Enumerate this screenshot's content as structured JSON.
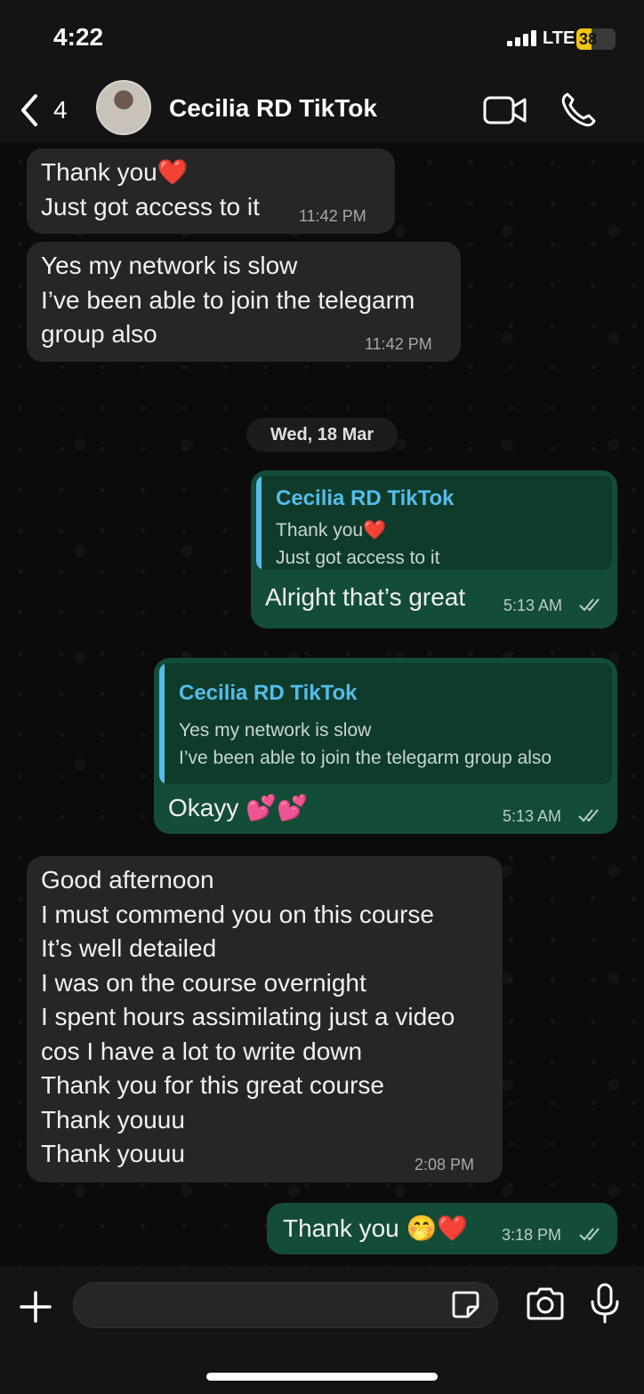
{
  "status_bar": {
    "time": "4:22",
    "network": "LTE",
    "battery": "38",
    "battery_level": 0.38,
    "battery_color": "#f2c40f"
  },
  "header": {
    "back_count": "4",
    "contact_name": "Cecilia RD TikTok",
    "icons": [
      "chevron-left-icon",
      "video-call-icon",
      "phone-icon"
    ]
  },
  "colors": {
    "incoming_bubble": "#262626",
    "outgoing_bubble": "#144d37",
    "quote_accent": "#53bdeb",
    "background": "#0b0b0b"
  },
  "date_separator": "Wed, 18 Mar",
  "messages": [
    {
      "direction": "in",
      "text": "Thank you❤️\nJust got access to it",
      "time": "11:42 PM"
    },
    {
      "direction": "in",
      "text": "Yes my network is slow\nI’ve been able to join the telegarm\ngroup also",
      "time": "11:42 PM"
    },
    {
      "direction": "out",
      "quote_author": "Cecilia RD TikTok",
      "quote_text": "Thank you❤️\nJust got access to it",
      "text": "Alright that’s great",
      "time": "5:13 AM",
      "status": "read"
    },
    {
      "direction": "out",
      "quote_author": "Cecilia RD TikTok",
      "quote_text": "Yes my network is slow\nI’ve been able to join the telegarm group also",
      "text": "Okayy 💕💕",
      "time": "5:13 AM",
      "status": "read"
    },
    {
      "direction": "in",
      "text": "Good afternoon\nI must commend you on this course\nIt’s well detailed\nI was on the course overnight\nI spent hours assimilating just a video\ncos I have a lot to write down\nThank you for this great course\nThank youuu\nThank youuu",
      "time": "2:08 PM"
    },
    {
      "direction": "out",
      "text": "Thank you 🤭❤️",
      "time": "3:18 PM",
      "status": "read"
    }
  ],
  "input_bar": {
    "value": "",
    "icons": [
      "plus-icon",
      "sticker-icon",
      "camera-icon",
      "microphone-icon"
    ]
  }
}
